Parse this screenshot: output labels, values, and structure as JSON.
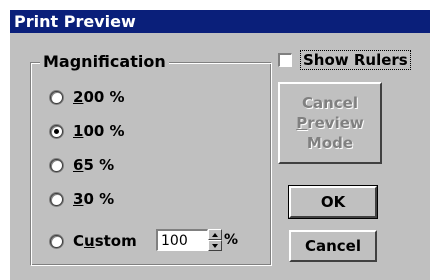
{
  "dialog": {
    "title": "Print Preview"
  },
  "magnification": {
    "label": "Magnification",
    "options": [
      {
        "pre": "",
        "u": "2",
        "post": "00 %",
        "checked": false
      },
      {
        "pre": "",
        "u": "1",
        "post": "00 %",
        "checked": true
      },
      {
        "pre": "",
        "u": "6",
        "post": "5 %",
        "checked": false
      },
      {
        "pre": "",
        "u": "3",
        "post": "0 %",
        "checked": false
      },
      {
        "pre": "C",
        "u": "u",
        "post": "stom",
        "checked": false
      }
    ],
    "custom_value": "100",
    "custom_unit": "%"
  },
  "show_rulers": {
    "label": "Show Rulers",
    "checked": false
  },
  "buttons": {
    "cancel_preview": {
      "line1": "Cancel",
      "line2_u": "P",
      "line2_rest": "review",
      "line3": "Mode",
      "enabled": false
    },
    "ok": "OK",
    "cancel": "Cancel"
  }
}
